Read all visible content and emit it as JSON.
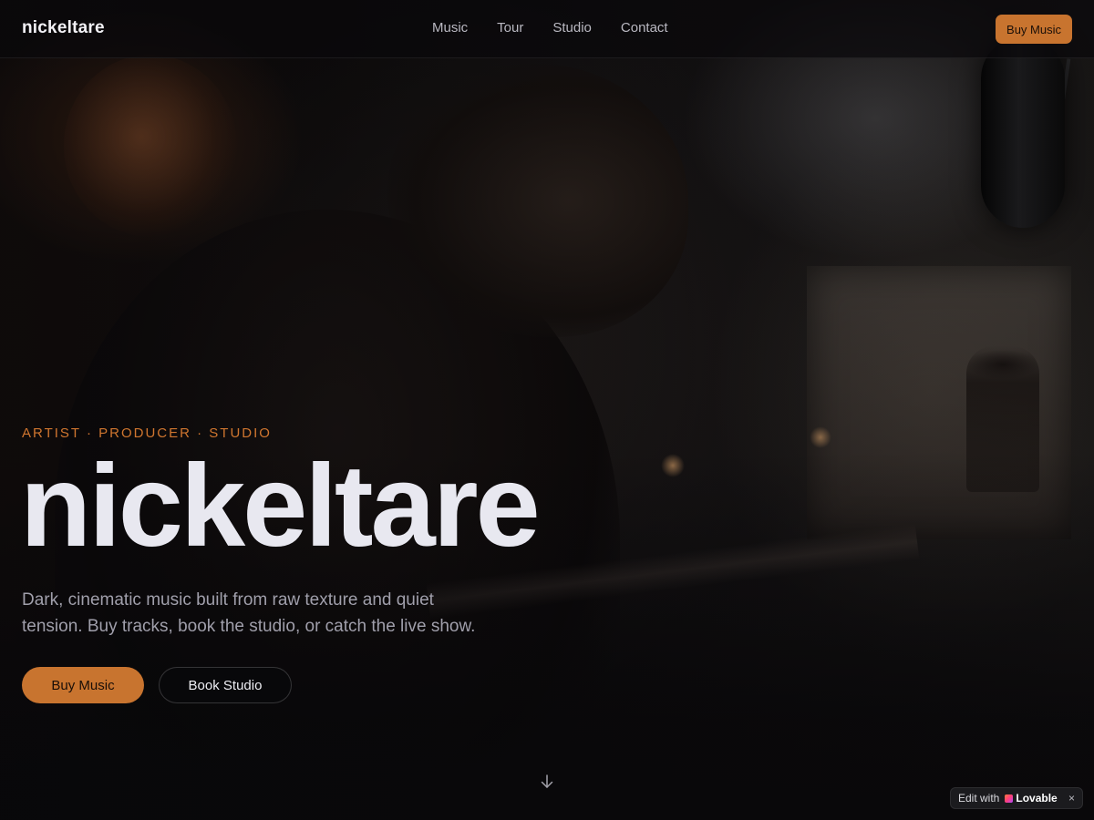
{
  "header": {
    "logo": "nickeltare",
    "nav": [
      "Music",
      "Tour",
      "Studio",
      "Contact"
    ],
    "cta_label": "Buy Music"
  },
  "hero": {
    "eyebrow": "ARTIST · PRODUCER · STUDIO",
    "title": "nickeltare",
    "lead_line1": "Dark, cinematic music built from raw texture and quiet",
    "lead_line2": "tension. Buy tracks, book the studio, or catch the live show.",
    "primary_button": "Buy Music",
    "secondary_button": "Book Studio",
    "scroll_icon": "arrow-down-icon"
  },
  "badge": {
    "edit_text": "Edit with",
    "brand": "Lovable",
    "close": "×"
  },
  "colors": {
    "accent": "#c8742f",
    "background": "#0b0a0b",
    "title": "#e8e8f0",
    "muted_text": "#a09fab"
  }
}
